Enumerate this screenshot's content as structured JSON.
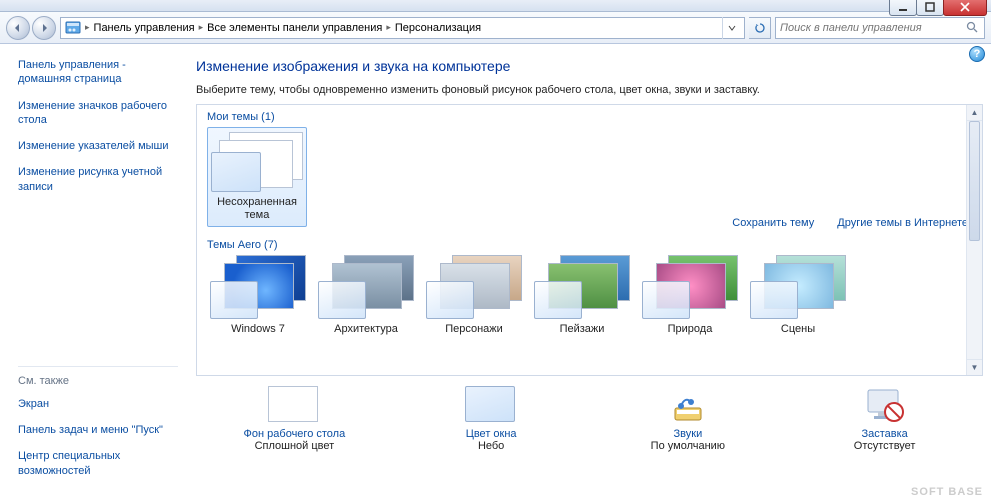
{
  "titlebar": {},
  "nav": {
    "breadcrumb": [
      "Панель управления",
      "Все элементы панели управления",
      "Персонализация"
    ],
    "search_placeholder": "Поиск в панели управления"
  },
  "sidebar": {
    "links": [
      "Панель управления - домашняя страница",
      "Изменение значков рабочего стола",
      "Изменение указателей мыши",
      "Изменение рисунка учетной записи"
    ],
    "see_also_title": "См. также",
    "see_also": [
      "Экран",
      "Панель задач и меню \"Пуск\"",
      "Центр специальных возможностей"
    ]
  },
  "main": {
    "title": "Изменение изображения и звука на компьютере",
    "subtitle": "Выберите тему, чтобы одновременно изменить фоновый рисунок рабочего стола, цвет окна, звуки и заставку.",
    "my_themes_title": "Мои темы (1)",
    "my_themes": [
      {
        "label": "Несохраненная тема",
        "selected": true
      }
    ],
    "save_theme": "Сохранить тему",
    "more_online": "Другие темы в Интернете",
    "aero_title": "Темы Aero (7)",
    "aero_themes": [
      {
        "label": "Windows 7",
        "bg1": "bg-win7a",
        "bg2": "bg-win7b"
      },
      {
        "label": "Архитектура",
        "bg1": "bg-arch1",
        "bg2": "bg-arch2"
      },
      {
        "label": "Персонажи",
        "bg1": "bg-char1",
        "bg2": "bg-char2"
      },
      {
        "label": "Пейзажи",
        "bg1": "bg-land1",
        "bg2": "bg-land2"
      },
      {
        "label": "Природа",
        "bg1": "bg-nat1",
        "bg2": "bg-nat2"
      },
      {
        "label": "Сцены",
        "bg1": "bg-scen1",
        "bg2": "bg-scen2"
      }
    ],
    "bottom": [
      {
        "title": "Фон рабочего стола",
        "value": "Сплошной цвет",
        "icon": "bg"
      },
      {
        "title": "Цвет окна",
        "value": "Небо",
        "icon": "wincolor"
      },
      {
        "title": "Звуки",
        "value": "По умолчанию",
        "icon": "sound"
      },
      {
        "title": "Заставка",
        "value": "Отсутствует",
        "icon": "saver"
      }
    ]
  },
  "watermark": "SOFT BASE"
}
